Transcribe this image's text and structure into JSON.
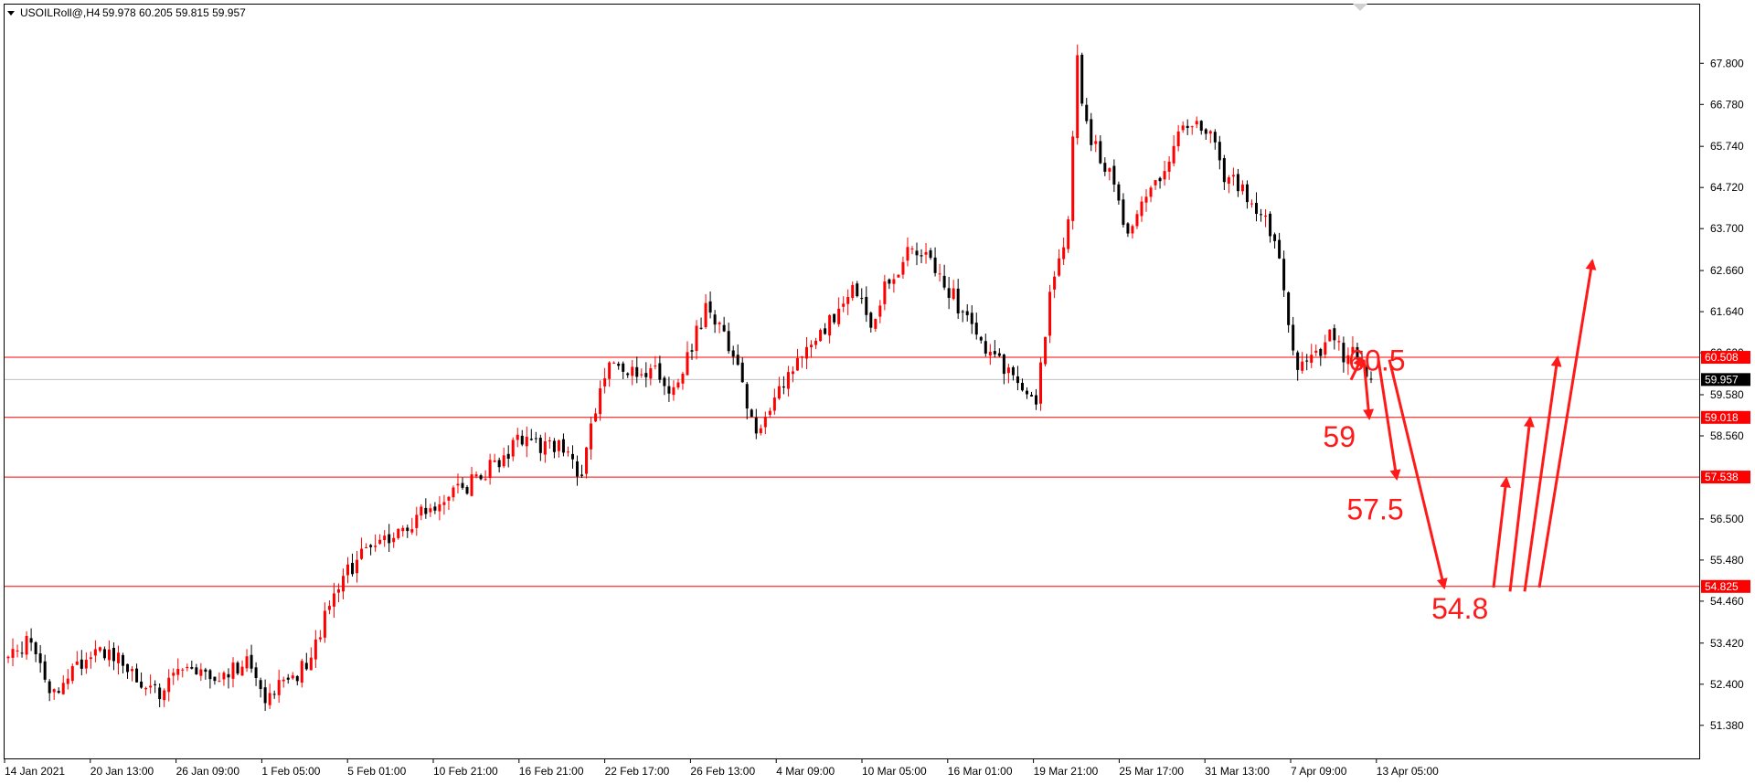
{
  "header": {
    "symbol": "USOILRoll@,H4",
    "ohlc": "59.978 60.205 59.815 59.957"
  },
  "colors": {
    "bull": "#ff0000",
    "bear": "#000000",
    "level_line": "#ff0000",
    "current_line": "#c0c0c0",
    "annotation": "#ff1a1a",
    "axis": "#000000",
    "current_label_bg": "#000000"
  },
  "chart_data": {
    "type": "candlestick",
    "ylim": [
      50.9,
      68.35
    ],
    "y_ticks": [
      "67.800",
      "66.780",
      "65.740",
      "64.720",
      "63.700",
      "62.660",
      "61.640",
      "60.620",
      "59.580",
      "58.560",
      "56.500",
      "55.480",
      "54.460",
      "53.420",
      "52.400",
      "51.380"
    ],
    "x_ticks": [
      "14 Jan 2021",
      "20 Jan 13:00",
      "26 Jan 09:00",
      "1 Feb 05:00",
      "5 Feb 01:00",
      "10 Feb 21:00",
      "16 Feb 21:00",
      "22 Feb 17:00",
      "26 Feb 13:00",
      "4 Mar 09:00",
      "10 Mar 05:00",
      "16 Mar 01:00",
      "19 Mar 21:00",
      "25 Mar 17:00",
      "31 Mar 13:00",
      "7 Apr 09:00",
      "13 Apr 05:00"
    ],
    "bar_count": 298,
    "path_closes": [
      [
        0,
        53.0
      ],
      [
        4,
        53.5
      ],
      [
        9,
        52.2
      ],
      [
        15,
        52.8
      ],
      [
        22,
        53.3
      ],
      [
        28,
        52.5
      ],
      [
        33,
        52.1
      ],
      [
        38,
        52.9
      ],
      [
        45,
        52.5
      ],
      [
        52,
        53.0
      ],
      [
        56,
        52.1
      ],
      [
        60,
        52.4
      ],
      [
        65,
        52.9
      ],
      [
        72,
        54.9
      ],
      [
        78,
        55.8
      ],
      [
        84,
        56.0
      ],
      [
        90,
        56.6
      ],
      [
        96,
        57.0
      ],
      [
        103,
        57.6
      ],
      [
        108,
        58.0
      ],
      [
        112,
        58.5
      ],
      [
        116,
        58.2
      ],
      [
        120,
        58.3
      ],
      [
        125,
        57.6
      ],
      [
        129,
        59.8
      ],
      [
        132,
        60.6
      ],
      [
        136,
        60.1
      ],
      [
        140,
        60.2
      ],
      [
        144,
        59.8
      ],
      [
        147,
        60.2
      ],
      [
        152,
        61.7
      ],
      [
        158,
        60.6
      ],
      [
        163,
        58.7
      ],
      [
        168,
        59.7
      ],
      [
        176,
        60.9
      ],
      [
        184,
        62.2
      ],
      [
        188,
        61.3
      ],
      [
        192,
        62.5
      ],
      [
        197,
        63.2
      ],
      [
        202,
        62.8
      ],
      [
        208,
        61.6
      ],
      [
        213,
        60.8
      ],
      [
        218,
        60.1
      ],
      [
        224,
        59.5
      ],
      [
        227,
        62.0
      ],
      [
        231,
        63.8
      ],
      [
        233,
        67.8
      ],
      [
        235,
        66.2
      ],
      [
        240,
        65.0
      ],
      [
        244,
        63.6
      ],
      [
        250,
        64.9
      ],
      [
        256,
        66.1
      ],
      [
        262,
        66.3
      ],
      [
        265,
        65.0
      ],
      [
        271,
        64.5
      ],
      [
        276,
        63.4
      ],
      [
        281,
        60.2
      ],
      [
        285,
        60.6
      ],
      [
        289,
        61.1
      ],
      [
        291,
        60.5
      ],
      [
        293,
        60.6
      ],
      [
        296,
        60.1
      ],
      [
        297,
        59.957
      ]
    ],
    "levels": [
      {
        "value": 60.508,
        "label": "60.508"
      },
      {
        "value": 59.018,
        "label": "59.018"
      },
      {
        "value": 57.538,
        "label": "57.538"
      },
      {
        "value": 54.825,
        "label": "54.825"
      }
    ],
    "current_price": {
      "value": 59.957,
      "label": "59.957"
    },
    "annotations": [
      {
        "text": "60.5",
        "x_fraction": 0.793,
        "value": 60.5
      },
      {
        "text": "59",
        "x_fraction": 0.778,
        "value": 58.6
      },
      {
        "text": "57.5",
        "x_fraction": 0.792,
        "value": 56.8
      },
      {
        "text": "54.8",
        "x_fraction": 0.842,
        "value": 54.35
      }
    ]
  }
}
